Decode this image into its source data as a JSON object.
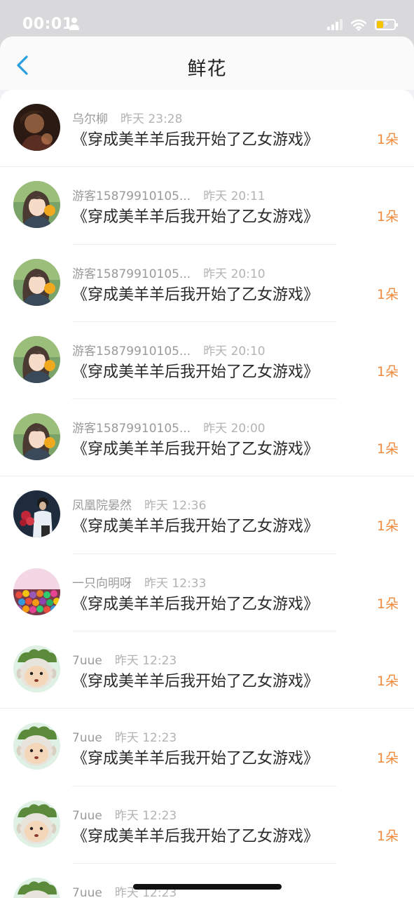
{
  "status_bar": {
    "time": "00:01"
  },
  "nav": {
    "title": "鲜花"
  },
  "items": [
    {
      "user": "乌尔柳",
      "time": "昨天 23:28",
      "book": "《穿成美羊羊后我开始了乙女游戏》",
      "count": "1朵",
      "avatar": "photo-woman"
    },
    {
      "user": "游客15879910105...",
      "time": "昨天 20:11",
      "book": "《穿成美羊羊后我开始了乙女游戏》",
      "count": "1朵",
      "avatar": "anime-girl"
    },
    {
      "user": "游客15879910105...",
      "time": "昨天 20:10",
      "book": "《穿成美羊羊后我开始了乙女游戏》",
      "count": "1朵",
      "avatar": "anime-girl"
    },
    {
      "user": "游客15879910105...",
      "time": "昨天 20:10",
      "book": "《穿成美羊羊后我开始了乙女游戏》",
      "count": "1朵",
      "avatar": "anime-girl"
    },
    {
      "user": "游客15879910105...",
      "time": "昨天 20:00",
      "book": "《穿成美羊羊后我开始了乙女游戏》",
      "count": "1朵",
      "avatar": "anime-girl"
    },
    {
      "user": "凤凰院晏然",
      "time": "昨天 12:36",
      "book": "《穿成美羊羊后我开始了乙女游戏》",
      "count": "1朵",
      "avatar": "man-flowers"
    },
    {
      "user": "一只向明呀",
      "time": "昨天 12:33",
      "book": "《穿成美羊羊后我开始了乙女游戏》",
      "count": "1朵",
      "avatar": "candy"
    },
    {
      "user": "7uue",
      "time": "昨天 12:23",
      "book": "《穿成美羊羊后我开始了乙女游戏》",
      "count": "1朵",
      "avatar": "cartoon-sheep"
    },
    {
      "user": "7uue",
      "time": "昨天 12:23",
      "book": "《穿成美羊羊后我开始了乙女游戏》",
      "count": "1朵",
      "avatar": "cartoon-sheep"
    },
    {
      "user": "7uue",
      "time": "昨天 12:23",
      "book": "《穿成美羊羊后我开始了乙女游戏》",
      "count": "1朵",
      "avatar": "cartoon-sheep"
    },
    {
      "user": "7uue",
      "time": "昨天 12:23",
      "book": "",
      "count": "",
      "avatar": "cartoon-sheep"
    }
  ]
}
